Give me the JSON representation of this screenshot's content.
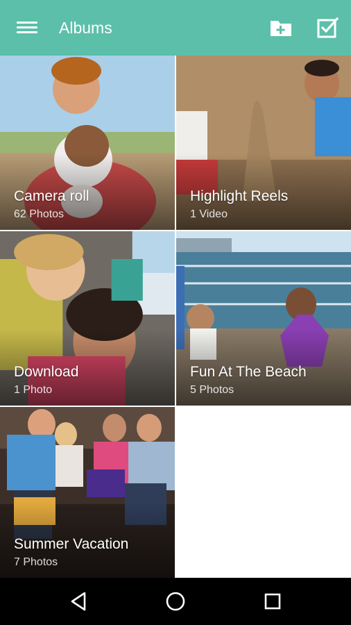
{
  "appbar": {
    "title": "Albums",
    "menu_icon": "hamburger-menu-icon",
    "new_folder_icon": "folder-add-icon",
    "select_icon": "checkbox-select-icon",
    "color": "#5bbfa9"
  },
  "albums": [
    {
      "name": "Camera roll",
      "count": "62 Photos"
    },
    {
      "name": "Highlight Reels",
      "count": "1 Video"
    },
    {
      "name": "Download",
      "count": "1 Photo"
    },
    {
      "name": "Fun At The Beach",
      "count": "5 Photos"
    },
    {
      "name": "Summer Vacation",
      "count": "7 Photos"
    }
  ],
  "navbar": {
    "back_icon": "back-triangle-icon",
    "home_icon": "home-circle-icon",
    "recents_icon": "recents-square-icon"
  }
}
